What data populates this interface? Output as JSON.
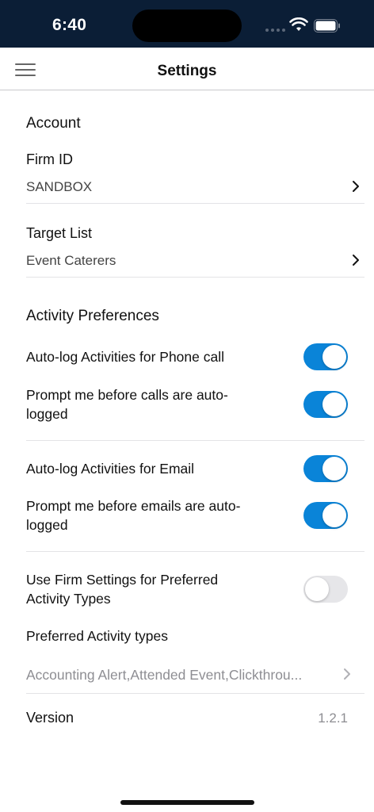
{
  "status_bar": {
    "time": "6:40"
  },
  "nav": {
    "title": "Settings",
    "menu_icon": "hamburger-icon"
  },
  "account": {
    "title": "Account",
    "firm_id": {
      "label": "Firm ID",
      "value": "SANDBOX"
    },
    "target_list": {
      "label": "Target List",
      "value": "Event Caterers"
    }
  },
  "activity": {
    "title": "Activity Preferences",
    "phone_autolog": {
      "label": "Auto-log Activities for Phone call",
      "on": true
    },
    "phone_prompt": {
      "label": "Prompt me before calls are auto-logged",
      "on": true
    },
    "email_autolog": {
      "label": "Auto-log Activities for Email",
      "on": true
    },
    "email_prompt": {
      "label": "Prompt me before emails are auto-logged",
      "on": true
    },
    "firm_settings": {
      "label": "Use Firm Settings for Preferred Activity Types",
      "on": false
    },
    "preferred_types": {
      "label": "Preferred Activity types",
      "value": "Accounting Alert,Attended Event,Clickthrou..."
    }
  },
  "version": {
    "label": "Version",
    "value": "1.2.1"
  },
  "colors": {
    "status_bar": "#0b1e36",
    "toggle_on": "#0a84d8",
    "toggle_off": "#e6e6e9"
  }
}
